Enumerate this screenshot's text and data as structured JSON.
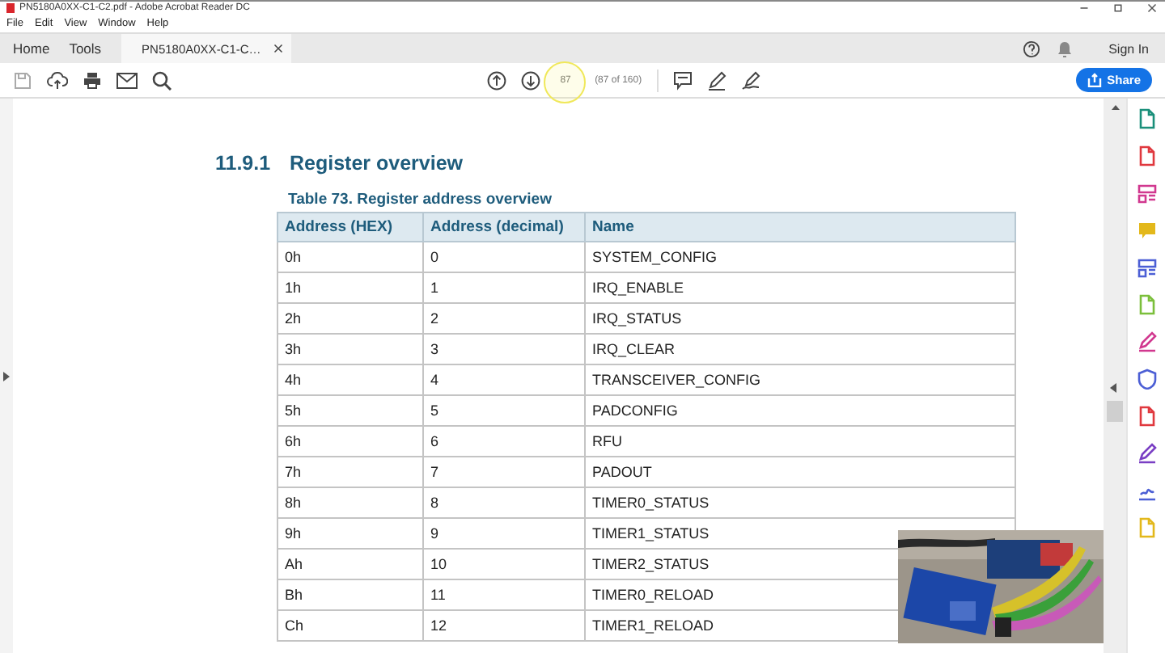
{
  "window": {
    "title": "PN5180A0XX-C1-C2.pdf - Adobe Acrobat Reader DC"
  },
  "menu": [
    "File",
    "Edit",
    "View",
    "Window",
    "Help"
  ],
  "tabs": [
    {
      "label": "Home",
      "selected": false
    },
    {
      "label": "Tools",
      "selected": false
    },
    {
      "label": "PN5180A0XX-C1-C…",
      "selected": true,
      "closable": true
    }
  ],
  "account": {
    "sign_in": "Sign In"
  },
  "toolbar": {
    "page_field": "87",
    "page_count": "(87 of 160)",
    "share": "Share"
  },
  "document": {
    "heading": {
      "number": "11.9.1",
      "title": "Register overview"
    },
    "table": {
      "caption": "Table 73.  Register address overview",
      "columns": [
        "Address (HEX)",
        "Address (decimal)",
        "Name"
      ],
      "rows": [
        [
          "0h",
          "0",
          "SYSTEM_CONFIG"
        ],
        [
          "1h",
          "1",
          "IRQ_ENABLE"
        ],
        [
          "2h",
          "2",
          "IRQ_STATUS"
        ],
        [
          "3h",
          "3",
          "IRQ_CLEAR"
        ],
        [
          "4h",
          "4",
          "TRANSCEIVER_CONFIG"
        ],
        [
          "5h",
          "5",
          "PADCONFIG"
        ],
        [
          "6h",
          "6",
          "RFU"
        ],
        [
          "7h",
          "7",
          "PADOUT"
        ],
        [
          "8h",
          "8",
          "TIMER0_STATUS"
        ],
        [
          "9h",
          "9",
          "TIMER1_STATUS"
        ],
        [
          "Ah",
          "10",
          "TIMER2_STATUS"
        ],
        [
          "Bh",
          "11",
          "TIMER0_RELOAD"
        ],
        [
          "Ch",
          "12",
          "TIMER1_RELOAD"
        ]
      ]
    }
  }
}
